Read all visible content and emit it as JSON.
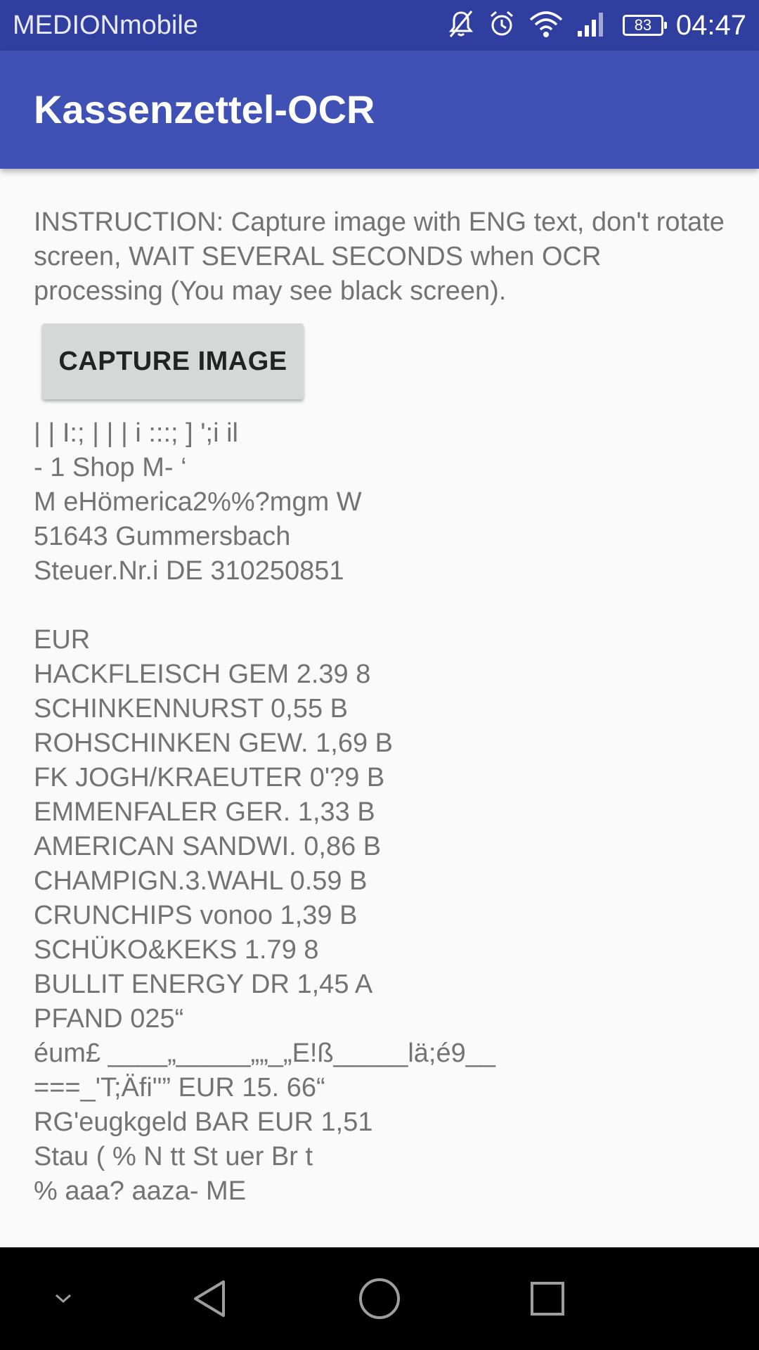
{
  "status_bar": {
    "carrier": "MEDIONmobile",
    "battery_level": "83",
    "time": "04:47",
    "icons": [
      "mute-icon",
      "alarm-icon",
      "wifi-icon",
      "signal-icon",
      "battery-icon"
    ],
    "background_color": "#303f9f"
  },
  "app_bar": {
    "title": "Kassenzettel-OCR",
    "background_color": "#3f51b5"
  },
  "main": {
    "instruction": "INSTRUCTION: Capture image with ENG text, don't rotate screen, WAIT SEVERAL SECONDS when OCR processing (You may see black screen).",
    "capture_button_label": "CAPTURE IMAGE",
    "ocr_lines": [
      "| | I:; | | | i :::; ] ';i il",
      "- 1 Shop M- ‘",
      "M eHömerica2%%?mgm W",
      "51643 Gummersbach",
      "Steuer.Nr.i DE 310250851",
      "",
      "EUR",
      "HACKFLEISCH GEM 2.39 8",
      "SCHINKENNURST 0,55 B",
      "ROHSCHINKEN GEW. 1,69 B",
      "FK JOGH/KRAEUTER 0'?9 B",
      "EMMENFALER GER. 1,33 B",
      "AMERICAN SANDWI. 0,86 B",
      "CHAMPIGN.3.WAHL 0.59 B",
      "CRUNCHIPS vonoo 1,39 B",
      "SCHÜKO&KEKS 1.79 8",
      "BULLIT ENERGY DR 1,45 A",
      "PFAND 025“",
      "éum£ ____„_____„„_„E!ß_____lä;é9__",
      "===_'T;Äfi\"” EUR 15. 66“",
      "RG'eugkgeld BAR EUR 1,51",
      "Stau ( % N tt St uer Br t",
      "% aaa? aaza- ME"
    ]
  },
  "nav_bar": {
    "buttons": [
      "collapse-icon",
      "back-icon",
      "home-icon",
      "recents-icon"
    ]
  }
}
